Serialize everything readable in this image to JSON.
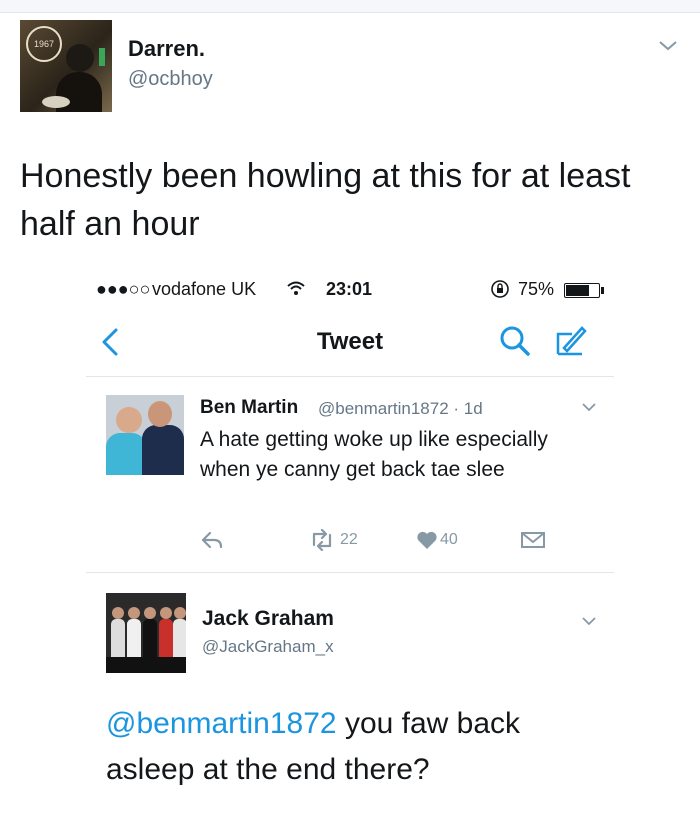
{
  "outer_tweet": {
    "name": "Darren.",
    "handle": "@ocbhoy",
    "avatar_badge": "1967",
    "text": "Honestly been howling at this for at least half an hour"
  },
  "screenshot": {
    "status_bar": {
      "signal": "●●●○○",
      "carrier": "vodafone UK",
      "time": "23:01",
      "battery": "75%",
      "battery_level": 0.75
    },
    "nav": {
      "title": "Tweet"
    },
    "tweet": {
      "name": "Ben Martin",
      "handle_time": "@benmartin1872 · 1d",
      "text": "A hate getting woke up like especially when ye canny get back tae slee",
      "retweets": "22",
      "likes": "40"
    },
    "reply": {
      "name": "Jack Graham",
      "handle": "@JackGraham_x",
      "mention": "@benmartin1872",
      "text": " you faw back asleep at the end there?"
    }
  },
  "colors": {
    "accent": "#1b95e0",
    "muted": "#657786",
    "icon_gray": "#8899a6",
    "divider": "#e1e8ed"
  }
}
